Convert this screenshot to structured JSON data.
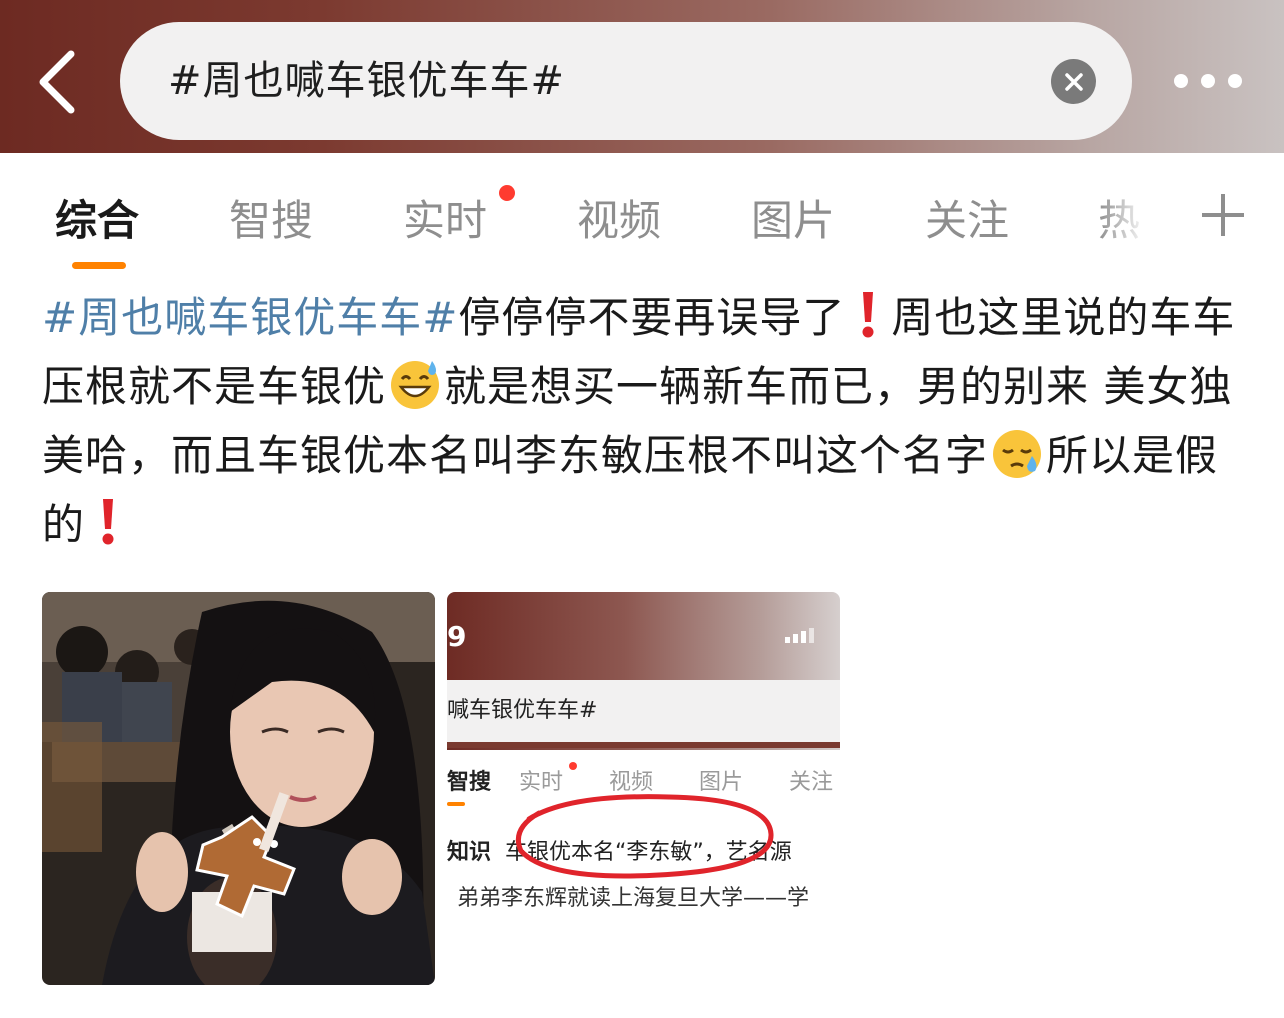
{
  "header": {
    "search_value": "#周也喊车银优车车#",
    "back_icon": "chevron-left-icon",
    "clear_icon": "clear-icon",
    "more_icon": "more-icon"
  },
  "tabs": [
    {
      "label": "综合",
      "active": true
    },
    {
      "label": "智搜"
    },
    {
      "label": "实时",
      "has_dot": true
    },
    {
      "label": "视频"
    },
    {
      "label": "图片"
    },
    {
      "label": "关注"
    },
    {
      "label": "热"
    }
  ],
  "post": {
    "hashtag": "#周也喊车银优车车#",
    "seg1": "停停停不要再误导了",
    "seg2": "周也这里说的车车压根就不是车银优",
    "seg3": "就是想买一辆新车而已，男的别来 美女独美哈，而且车银优本名叫李东敏压根不叫这个名字",
    "seg4": "所以是假的"
  },
  "screenshot": {
    "time": "9",
    "search": "喊车银优车车#",
    "tabs": [
      "智搜",
      "实时",
      "视频",
      "图片",
      "关注"
    ],
    "line1_prefix": "知识",
    "line1": "车银优本名“李东敏”，艺名源",
    "line2": "弟弟李东辉就读上海复旦大学——学"
  },
  "colors": {
    "hashtag": "#4f7fa8",
    "tab_underline": "#ff8200",
    "red_dot": "#ff3b30"
  }
}
